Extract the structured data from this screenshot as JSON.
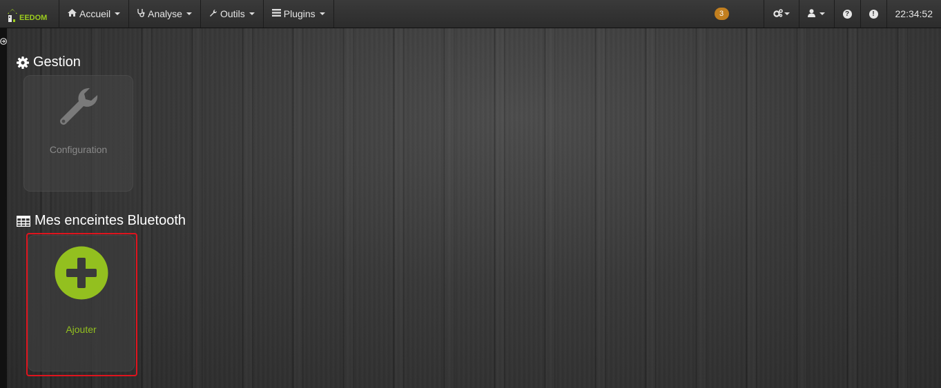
{
  "brand": {
    "name": "EEDOM",
    "color": "#9ccd1e"
  },
  "nav": {
    "items": [
      {
        "icon": "home-icon",
        "label": "Accueil"
      },
      {
        "icon": "stethoscope-icon",
        "label": "Analyse"
      },
      {
        "icon": "wrench-icon",
        "label": "Outils"
      },
      {
        "icon": "list-icon",
        "label": "Plugins"
      }
    ],
    "badge_count": "3",
    "right_icons": [
      "cogs-icon",
      "user-icon",
      "help-icon",
      "info-icon"
    ],
    "clock": "22:34:52"
  },
  "gestion": {
    "title": "Gestion",
    "title_icon": "gear-icon",
    "cards": [
      {
        "icon": "wrench-icon",
        "label": "Configuration"
      }
    ]
  },
  "enceintes": {
    "title": "Mes enceintes Bluetooth",
    "title_icon": "table-icon",
    "cards": [
      {
        "icon": "plus-circle-icon",
        "label": "Ajouter"
      }
    ]
  },
  "colors": {
    "accent": "#9ccd1e",
    "highlight": "#e0141e",
    "badge": "#c27f1f"
  }
}
